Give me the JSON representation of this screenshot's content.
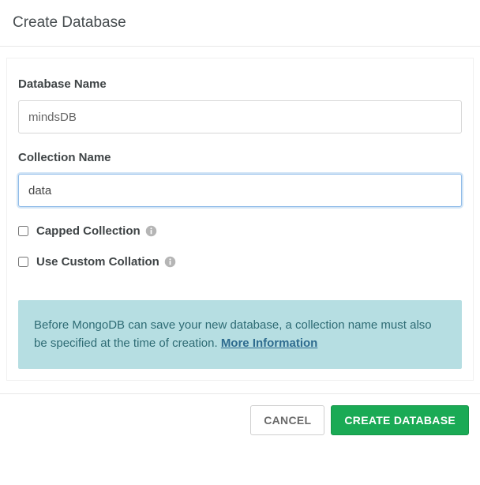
{
  "header": {
    "title": "Create Database"
  },
  "fields": {
    "dbName": {
      "label": "Database Name",
      "value": "mindsDB"
    },
    "collectionName": {
      "label": "Collection Name",
      "value": "data"
    }
  },
  "options": {
    "capped": {
      "label": "Capped Collection",
      "checked": false
    },
    "collation": {
      "label": "Use Custom Collation",
      "checked": false
    }
  },
  "notice": {
    "text": "Before MongoDB can save your new database, a collection name must also be specified at the time of creation.",
    "linkText": "More Information"
  },
  "footer": {
    "cancel": "CANCEL",
    "create": "CREATE DATABASE"
  }
}
